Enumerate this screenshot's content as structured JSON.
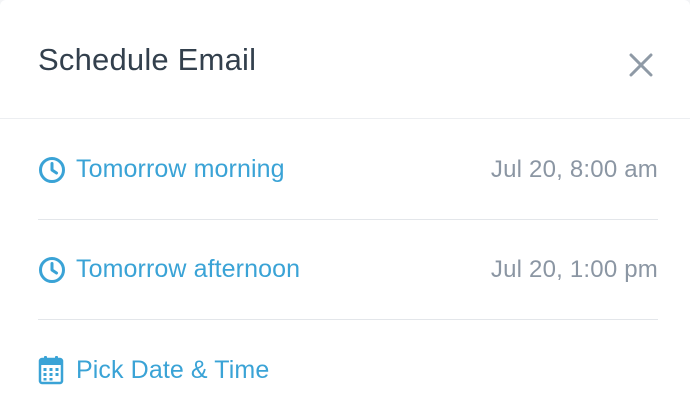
{
  "dialog": {
    "title": "Schedule Email",
    "close_icon": "close-icon"
  },
  "options": [
    {
      "icon": "clock-icon",
      "label": "Tomorrow morning",
      "time": "Jul 20, 8:00 am"
    },
    {
      "icon": "clock-icon",
      "label": "Tomorrow afternoon",
      "time": "Jul 20, 1:00 pm"
    },
    {
      "icon": "calendar-icon",
      "label": "Pick Date & Time",
      "time": ""
    }
  ],
  "colors": {
    "accent": "#3aa3d6",
    "title": "#33404d",
    "muted": "#8b96a3",
    "divider": "#e3e6ea"
  }
}
